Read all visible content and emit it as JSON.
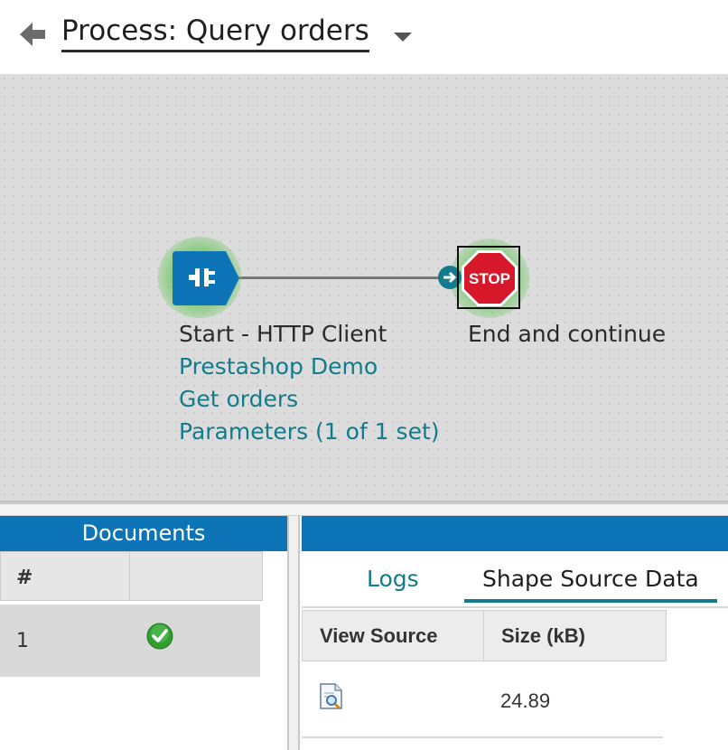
{
  "header": {
    "back_icon": "arrow-left-icon",
    "title": "Process: Query orders",
    "menu_icon": "caret-down-icon"
  },
  "canvas": {
    "start_shape": {
      "icon": "plug-connector-icon",
      "title": "Start - HTTP Client",
      "connection": "Prestashop Demo",
      "operation": "Get orders",
      "parameters": "Parameters (1 of 1 set)"
    },
    "stop_shape": {
      "icon": "stop-sign-icon",
      "sign_text": "STOP",
      "title": "End and continue"
    },
    "colors": {
      "accent": "#127b8c",
      "start_fill": "#0d74b8",
      "stop_red": "#d7182a",
      "glow": "#78c86e"
    }
  },
  "documents_panel": {
    "title": "Documents",
    "columns": [
      "#",
      ""
    ],
    "rows": [
      {
        "num": "1",
        "status_icon": "check-success-icon"
      }
    ]
  },
  "details_panel": {
    "tabs": [
      {
        "label": "Logs",
        "active": false
      },
      {
        "label": "Shape Source Data",
        "active": true
      }
    ],
    "columns": [
      "View Source",
      "Size (kB)"
    ],
    "rows": [
      {
        "view_icon": "view-document-icon",
        "size": "24.89"
      }
    ]
  }
}
